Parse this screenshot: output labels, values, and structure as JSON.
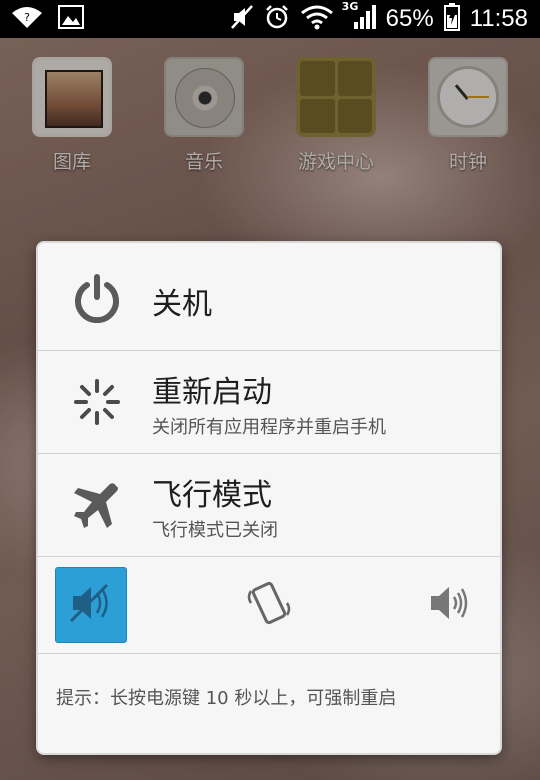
{
  "status_bar": {
    "network_label": "3G",
    "battery": "65%",
    "time": "11:58",
    "icons": [
      "wifi-question-icon",
      "image-notification-icon",
      "mute-icon",
      "alarm-icon",
      "wifi-icon",
      "signal-icon",
      "battery-charging-icon"
    ]
  },
  "home": {
    "apps": [
      {
        "label": "图库",
        "icon": "gallery-icon"
      },
      {
        "label": "音乐",
        "icon": "music-icon"
      },
      {
        "label": "游戏中心",
        "icon": "game-center-icon"
      },
      {
        "label": "时钟",
        "icon": "clock-icon"
      }
    ]
  },
  "dialog": {
    "power_off": {
      "title": "关机",
      "icon": "power-icon"
    },
    "reboot": {
      "title": "重新启动",
      "subtitle": "关闭所有应用程序并重启手机",
      "icon": "reboot-icon"
    },
    "airplane": {
      "title": "飞行模式",
      "subtitle": "飞行模式已关闭",
      "icon": "airplane-icon"
    },
    "sound_modes": [
      {
        "name": "silent",
        "icon": "silent-icon",
        "selected": true
      },
      {
        "name": "vibrate",
        "icon": "vibrate-icon",
        "selected": false
      },
      {
        "name": "sound",
        "icon": "speaker-icon",
        "selected": false
      }
    ],
    "hint": "提示：长按电源键 10 秒以上，可强制重启"
  },
  "colors": {
    "accent": "#2b9fd6",
    "dialog_bg": "#f6f6f6",
    "status_bar": "#000000"
  }
}
